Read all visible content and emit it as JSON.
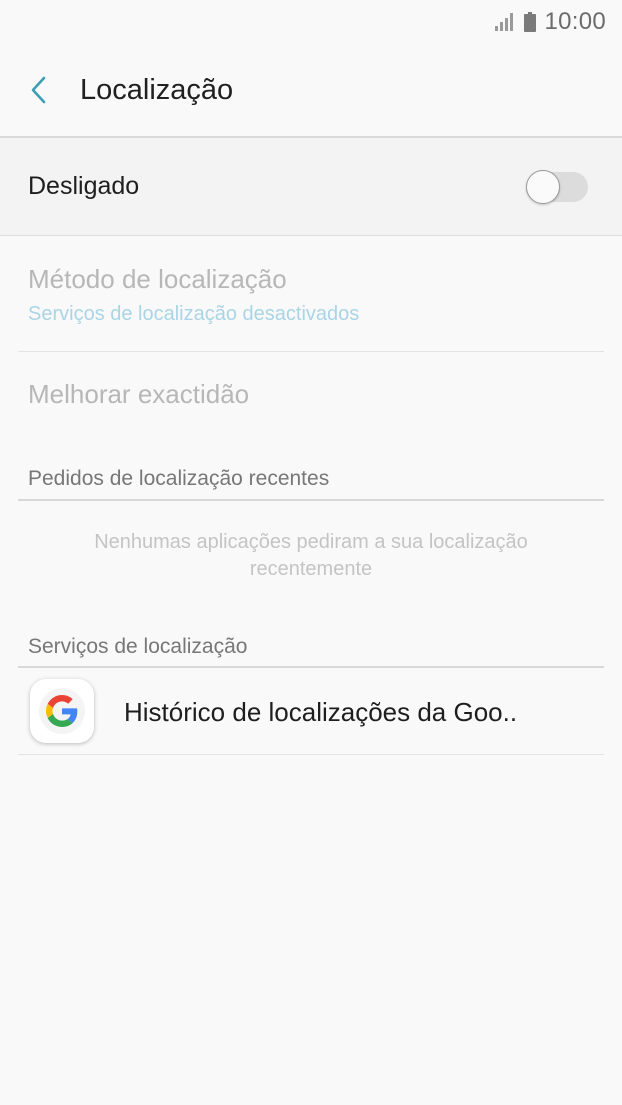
{
  "status_bar": {
    "time": "10:00",
    "signal_icon": "signal-icon",
    "battery_icon": "battery-icon"
  },
  "header": {
    "back_icon": "chevron-left-icon",
    "title": "Localização",
    "accent_color": "#3d9db3"
  },
  "location_toggle": {
    "label": "Desligado",
    "state": "off"
  },
  "settings": {
    "method": {
      "title": "Método de localização",
      "subtitle": "Serviços de localização desactivados"
    },
    "accuracy": {
      "title": "Melhorar exactidão"
    }
  },
  "recent_requests": {
    "header": "Pedidos de localização recentes",
    "empty_line1": "Nenhumas aplicações pediram a sua localização",
    "empty_line2": "recentemente"
  },
  "location_services": {
    "header": "Serviços de localização",
    "items": [
      {
        "label": "Histórico de localizações da Goo..",
        "icon": "google-icon"
      }
    ]
  }
}
